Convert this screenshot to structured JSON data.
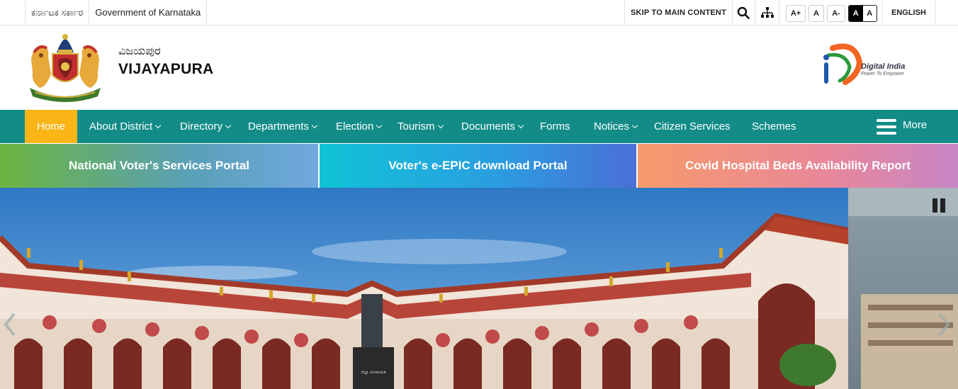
{
  "topbar": {
    "kannada_gov": "ಕರ್ನಾಟಕ ಸರ್ಕಾರ",
    "gov_name": "Government of Karnataka",
    "skip_link": "SKIP TO MAIN CONTENT",
    "font_increase": "A+",
    "font_normal": "A",
    "font_decrease": "A-",
    "contrast_dark": "A",
    "contrast_light": "A",
    "language": "ENGLISH"
  },
  "header": {
    "title_kannada": "ವಿಜಯಪುರ",
    "title_english": "VIJAYAPURA",
    "digital_india": "Digital India",
    "digital_india_tagline": "Power To Empower"
  },
  "nav": {
    "items": [
      {
        "label": "Home",
        "dropdown": false,
        "active": true
      },
      {
        "label": "About District",
        "dropdown": true
      },
      {
        "label": "Directory",
        "dropdown": true
      },
      {
        "label": "Departments",
        "dropdown": true
      },
      {
        "label": "Election",
        "dropdown": true
      },
      {
        "label": "Tourism",
        "dropdown": true
      },
      {
        "label": "Documents",
        "dropdown": true
      },
      {
        "label": "Forms",
        "dropdown": false
      },
      {
        "label": "Notices",
        "dropdown": true
      },
      {
        "label": "Citizen Services",
        "dropdown": false
      },
      {
        "label": "Schemes",
        "dropdown": false
      }
    ],
    "more_label": "More"
  },
  "portals": [
    {
      "label": "National Voter's Services Portal"
    },
    {
      "label": "Voter's e-EPIC download Portal"
    },
    {
      "label": "Covid Hospital Beds Availability Report"
    }
  ],
  "banner": {
    "statue_plaque": "ಜಿಲ್ಲಾ ಪಂಚಾಯತ"
  },
  "colors": {
    "nav_bg": "#138c87",
    "nav_active": "#f9b516",
    "text_dark": "#111111"
  },
  "icons": {
    "search": "search-icon",
    "sitemap": "sitemap-icon",
    "more": "hamburger-menu-icon",
    "pause": "pause-icon",
    "prev": "chevron-left-icon",
    "next": "chevron-right-icon"
  }
}
